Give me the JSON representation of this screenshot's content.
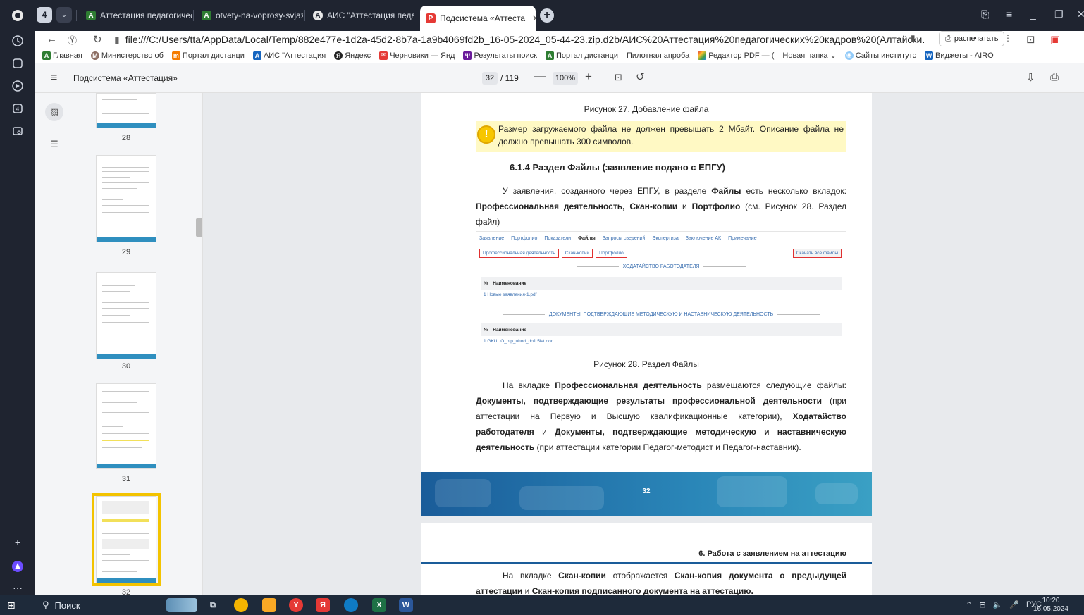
{
  "browser": {
    "tab_count": "4",
    "tabs": [
      {
        "label": "Аттестация педагогическ"
      },
      {
        "label": "otvety-na-voprosy-svjazar"
      },
      {
        "label": "АИС \"Аттестация педагог"
      },
      {
        "label": "Подсистема «Аттеста"
      }
    ],
    "address": "file:///C:/Users/tta/AppData/Local/Temp/882e477e-1d2a-45d2-8b7a-1a9b4069fd2b_16-05-2024_05-44-23.zip.d2b/АИС%20Аттестация%20педагогических%20кадров%20(Алтайски...",
    "print_label": "распечатать",
    "bookmarks": [
      "Главная",
      "Министерство об",
      "Портал дистанци",
      "АИС \"Аттестация",
      "Яндекс",
      "Черновики — Янд",
      "Результаты поиск",
      "Портал дистанци",
      "Пилотная апроба",
      "Редактор PDF — (",
      "Новая папка",
      "Сайты институтс",
      "Виджеты - AIRO"
    ]
  },
  "pdf_toolbar": {
    "title": "Подсистема «Аттестация»",
    "current_page": "32",
    "total_pages": "/ 119",
    "zoom": "100%"
  },
  "thumbnails": [
    {
      "num": "28"
    },
    {
      "num": "29"
    },
    {
      "num": "30"
    },
    {
      "num": "31"
    },
    {
      "num": "32"
    }
  ],
  "page": {
    "caption_27": "Рисунок 27. Добавление файла",
    "warning": "Размер загружаемого файла не должен превышать 2 Мбайт. Описание файла не должно превышать 300 символов.",
    "heading": "6.1.4    Раздел Файлы (заявление подано с ЕПГУ)",
    "para1_a": "У заявления, созданного через ЕПГУ, в разделе ",
    "para1_b": "Файлы",
    "para1_c": " есть несколько вкладок: ",
    "para1_d": "Профессиональная деятельность, Скан-копии",
    "para1_e": " и ",
    "para1_f": "Портфолио",
    "para1_g": " (см. Рисунок 28. Раздел файл)",
    "figure": {
      "tabs": [
        "Заявление",
        "Портфолио",
        "Показатели",
        "Файлы",
        "Запросы сведений",
        "Экспертиза",
        "Заключение АК",
        "Примечание"
      ],
      "subtabs": [
        "Профессиональная деятельность",
        "Скан-копии",
        "Портфолио"
      ],
      "download_all": "Скачать все файлы",
      "section1": "ХОДАТАЙСТВО РАБОТОДАТЕЛЯ",
      "col_num": "№",
      "col_name": "Наименование",
      "row1": "1   Новые заявления-1.pdf",
      "section2": "ДОКУМЕНТЫ, ПОДТВЕРЖДАЮЩИЕ МЕТОДИЧЕСКУЮ И НАСТАВНИЧЕСКУЮ ДЕЯТЕЛЬНОСТЬ",
      "row2": "1   GKUUO_otp_uhod_do1.5let.doc"
    },
    "caption_28": "Рисунок 28. Раздел Файлы",
    "para2_a": "На вкладке ",
    "para2_b": "Профессиональная деятельность",
    "para2_c": " размещаются следующие файлы: ",
    "para2_d": "Документы, подтверждающие результаты профессиональной деятельности",
    "para2_e": " (при аттестации на Первую и Высшую квалификационные категории), ",
    "para2_f": "Ходатайство работодателя",
    "para2_g": " и ",
    "para2_h": "Документы, подтверждающие методическую и наставническую деятельность",
    "para2_i": " (при аттестации категории Педагог-методист и Педагог-наставник).",
    "page_number": "32"
  },
  "page2": {
    "header": "6. Работа с заявлением на аттестацию",
    "para_a": "На вкладке ",
    "para_b": "Скан-копии",
    "para_c": " отображается ",
    "para_d": "Скан-копия документа о предыдущей аттестации",
    "para_e": " и ",
    "para_f": "Скан-копия подписанного документа на аттестацию."
  },
  "taskbar": {
    "search_label": "Поиск",
    "lang": "РУС",
    "time": "10:20",
    "date": "16.05.2024"
  },
  "colors": {
    "accent": "#1a5c99",
    "highlight": "#f3c300",
    "warning_bg": "#fff9c4"
  }
}
